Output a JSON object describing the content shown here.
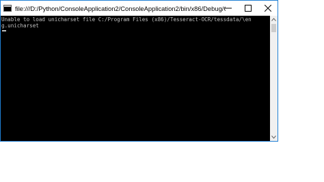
{
  "window": {
    "title": "file:///D:/Python/ConsoleApplication2/ConsoleApplication2/bin/x86/Debug/ConsoleAppli...",
    "accent_color": "#1f7fd4"
  },
  "caption": {
    "minimize_icon": "minimize-icon",
    "maximize_icon": "maximize-icon",
    "close_icon": "close-icon"
  },
  "console": {
    "lines": [
      "Unable to load unicharset file C:/Program Files (x86)/Tesseract-OCR/tessdata/\\en",
      "g.unicharset"
    ],
    "text_color": "#c0c0c0",
    "background": "#000000"
  }
}
